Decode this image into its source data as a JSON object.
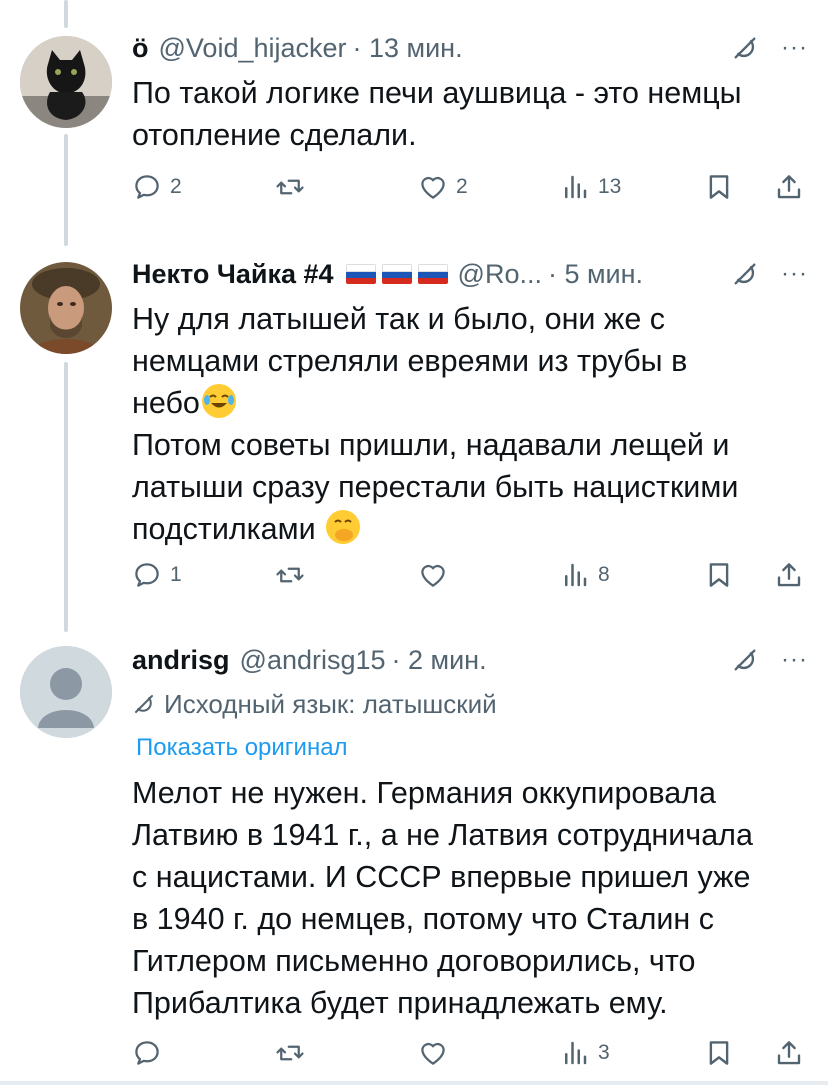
{
  "tweets": [
    {
      "name": "ö",
      "handle": "@Void_hijacker",
      "time": "· 13 мин.",
      "text_lines": [
        "По такой логике печи аушвица - это немцы",
        "отопление сделали."
      ],
      "actions": {
        "replies": "2",
        "retweets": "",
        "likes": "2",
        "views": "13"
      }
    },
    {
      "name": "Некто Чайка #4",
      "handle": "@Ro...",
      "time": "· 5 мин.",
      "text_lines": [
        "Ну для латышей так и было, они же с",
        "немцами стреляли евреями из трубы в",
        "небо",
        "Потом советы пришли, надавали лещей и",
        "латыши сразу перестали быть нацисткими",
        "подстилками"
      ],
      "emoji": [
        "face-with-tears-of-joy",
        "face-with-hand-over-mouth"
      ],
      "actions": {
        "replies": "1",
        "retweets": "",
        "likes": "",
        "views": "8"
      }
    },
    {
      "name": "andrisg",
      "handle": "@andrisg15",
      "time": "· 2 мин.",
      "translate_note": "Исходный язык: латышский",
      "show_original": "Показать оригинал",
      "text_lines": [
        "Мелот не нужен. Германия оккупировала",
        "Латвию в 1941 г., а не Латвия сотрудничала",
        "с нацистами. И СССР впервые пришел уже",
        "в 1940 г. до немцев, потому что Сталин с",
        "Гитлером письменно договорились, что",
        "Прибалтика будет принадлежать ему."
      ],
      "actions": {
        "replies": "",
        "retweets": "",
        "likes": "",
        "views": "3"
      }
    }
  ],
  "more_label": "···",
  "icons": [
    "grok-icon",
    "reply-icon",
    "retweet-icon",
    "like-icon",
    "views-icon",
    "bookmark-icon",
    "share-icon"
  ],
  "colors": {
    "text": "#0f1419",
    "muted": "#536471",
    "link": "#1d9bf0",
    "thread_line": "#cfd9de"
  }
}
